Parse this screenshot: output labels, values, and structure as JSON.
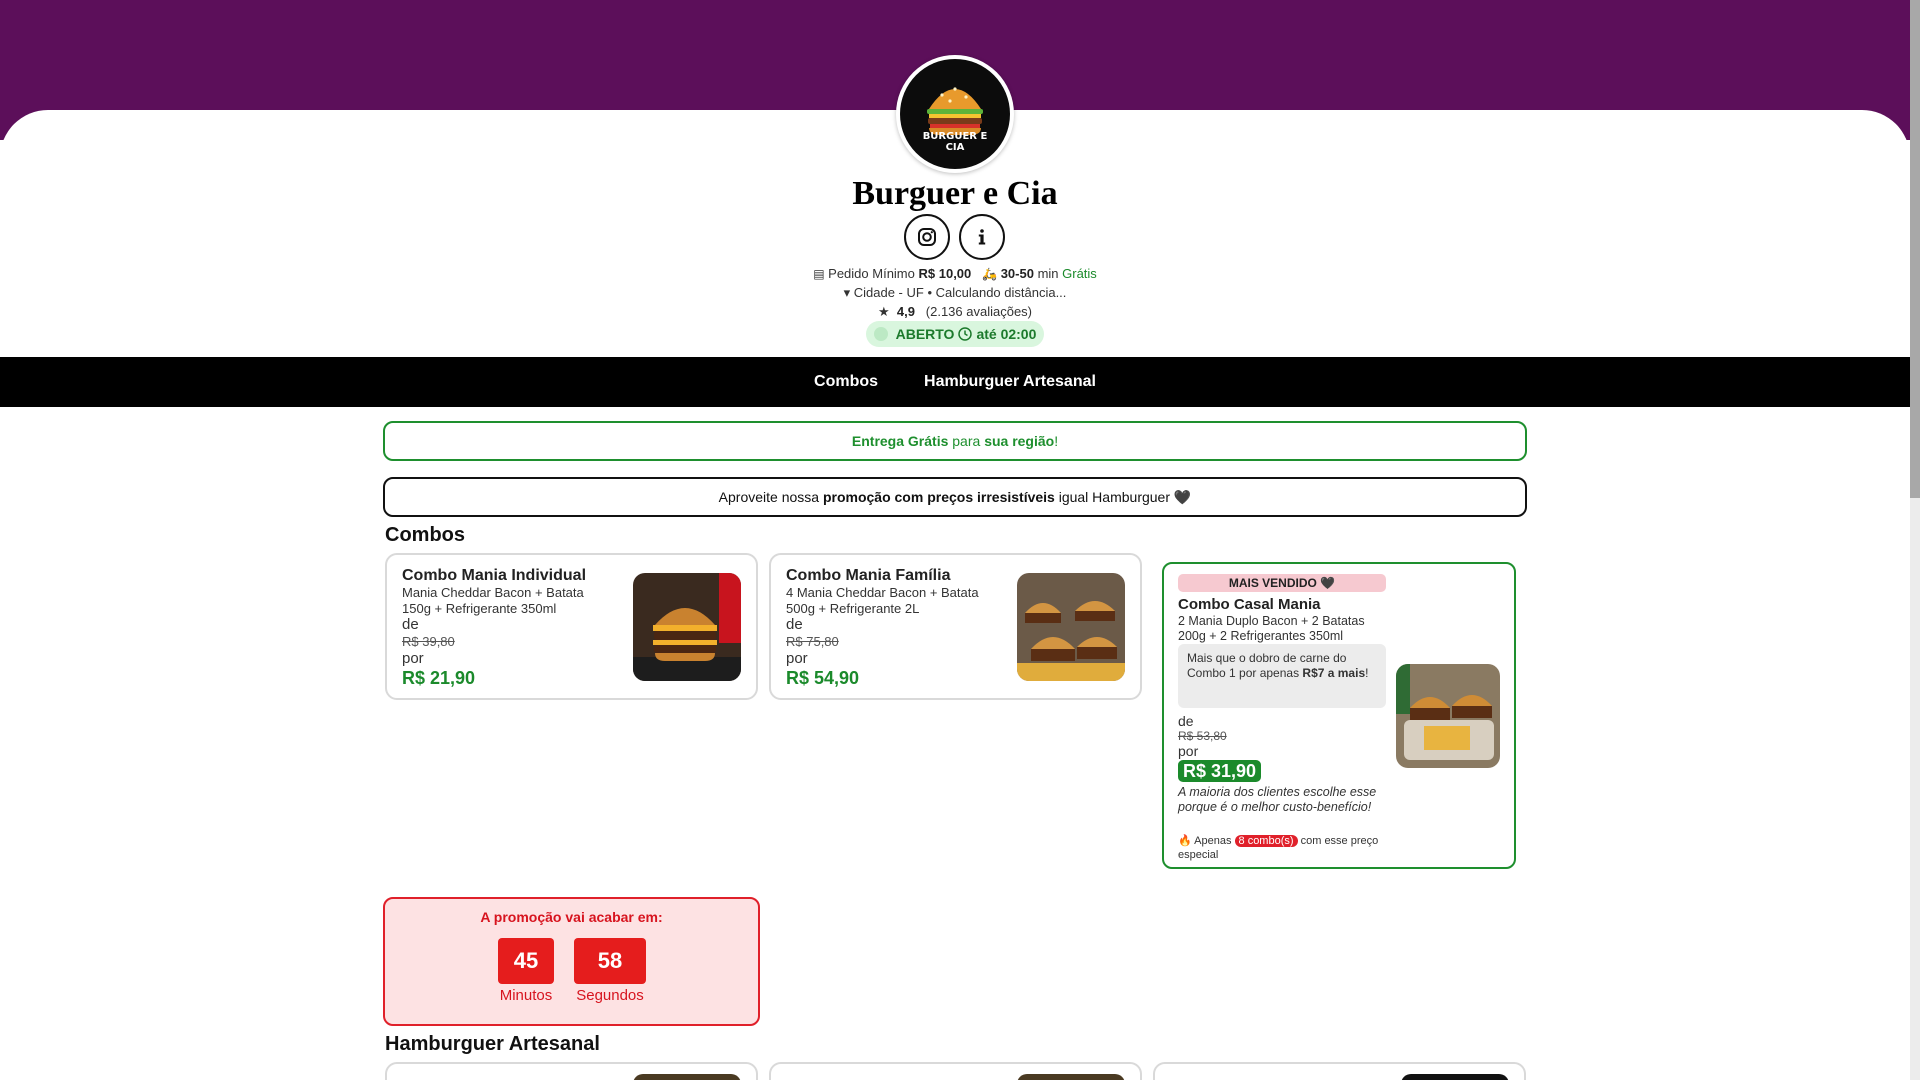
{
  "store": {
    "name": "Burguer e Cia",
    "logo_text_line1": "BURGUER E",
    "logo_text_line2": "CIA"
  },
  "info": {
    "min_order_label": "Pedido Mínimo",
    "min_order_value": "R$ 10,00",
    "delivery_time": "30-50",
    "delivery_time_unit": "min",
    "delivery_fee": "Grátis",
    "location": "Cidade - UF • Calculando distância...",
    "rating": "4,9",
    "reviews": "(2.136 avaliações)",
    "open_status": "ABERTO",
    "open_until": "até 02:00"
  },
  "nav": {
    "items": [
      "Combos",
      "Hamburguer Artesanal"
    ]
  },
  "banners": {
    "delivery_part1": "Entrega Grátis",
    "delivery_part2": " para ",
    "delivery_part3": "sua região",
    "delivery_part4": "!",
    "promo_part1": "Aproveite nossa ",
    "promo_part2": "promoção com preços irresistíveis",
    "promo_part3": " igual Hamburguer 🖤"
  },
  "sections": {
    "combos": "Combos",
    "artesanal": "Hamburguer Artesanal"
  },
  "products": [
    {
      "title": "Combo Mania Individual",
      "desc_line1": "Mania Cheddar Bacon + Batata",
      "desc_line2": "150g + Refrigerante 350ml",
      "from_label": "de",
      "old_price": "R$ 39,80",
      "to_label": "por",
      "price": "R$ 21,90"
    },
    {
      "title": "Combo Mania Família",
      "desc_line1": "4 Mania Cheddar Bacon + Batata",
      "desc_line2": "500g + Refrigerante 2L",
      "from_label": "de",
      "old_price": "R$ 75,80",
      "to_label": "por",
      "price": "R$ 54,90"
    }
  ],
  "featured": {
    "badge": "MAIS VENDIDO 🖤",
    "title": "Combo Casal Mania",
    "desc_line1": "2 Mania Duplo Bacon + 2 Batatas",
    "desc_line2": "200g + 2 Refrigerantes 350ml",
    "note_part1": "Mais que o dobro de carne do Combo 1 por apenas ",
    "note_part2": "R$7 a mais",
    "note_part3": "!",
    "from_label": "de",
    "old_price": "R$ 53,80",
    "to_label": "por",
    "price": "R$ 31,90",
    "italic_note": "A maioria dos clientes escolhe esse porque é o melhor custo-benefício!",
    "stock_prefix": "🔥 Apenas ",
    "stock_count": "8 combo(s)",
    "stock_suffix": " com esse preço especial"
  },
  "countdown": {
    "title": "A promoção vai acabar em:",
    "minutes": "45",
    "minutes_label": "Minutos",
    "seconds": "58",
    "seconds_label": "Segundos"
  },
  "colors": {
    "brand_purple": "#5c0f5a",
    "accent_green": "#1b8a2b",
    "alert_red": "#e51d1d"
  }
}
